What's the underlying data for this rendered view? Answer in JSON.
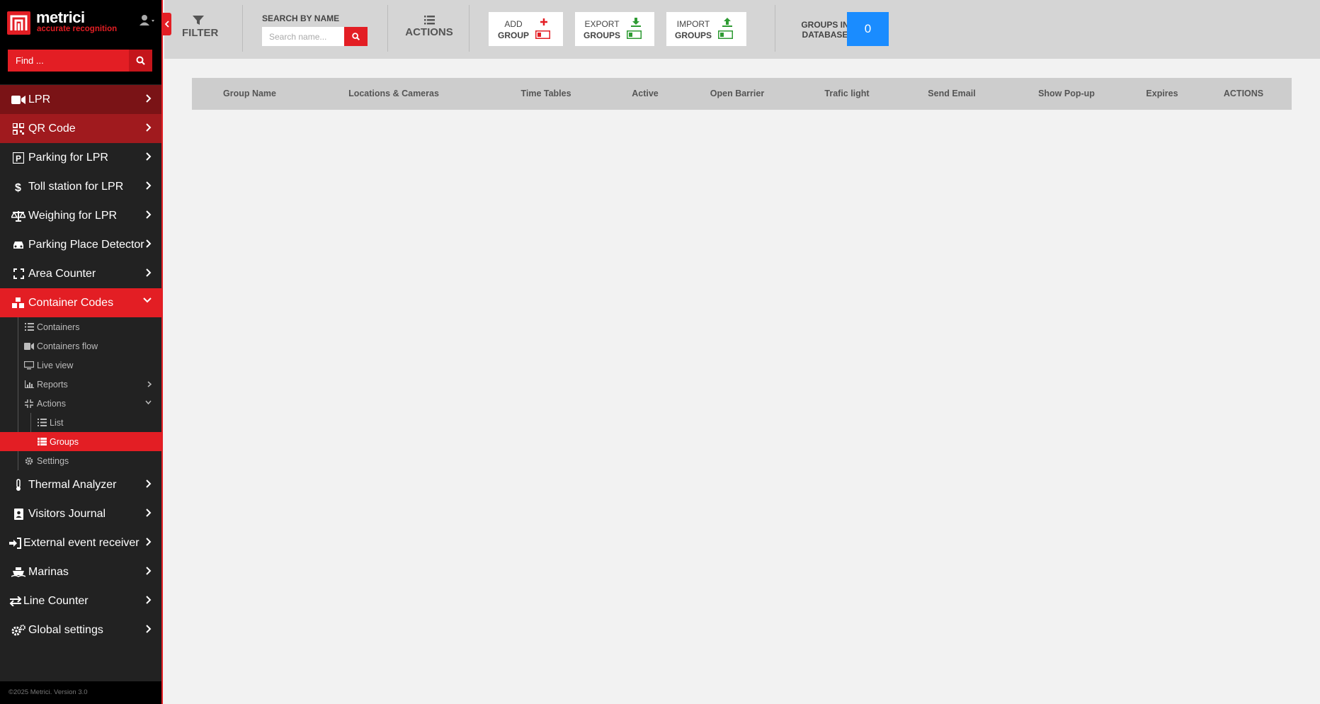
{
  "brand": {
    "name": "metrici",
    "tagline": "accurate recognition",
    "accent": "#e31e24"
  },
  "search_sidebar": {
    "placeholder": "Find ..."
  },
  "nav": [
    {
      "label": "LPR",
      "icon": "video-camera-icon"
    },
    {
      "label": "QR Code",
      "icon": "qr-code-icon"
    },
    {
      "label": "Parking for LPR",
      "icon": "parking-icon"
    },
    {
      "label": "Toll station for LPR",
      "icon": "dollar-icon"
    },
    {
      "label": "Weighing for LPR",
      "icon": "scale-icon"
    },
    {
      "label": "Parking Place Detector",
      "icon": "car-icon"
    },
    {
      "label": "Area Counter",
      "icon": "expand-icon"
    },
    {
      "label": "Container Codes",
      "icon": "cubes-icon"
    }
  ],
  "container_sub": [
    {
      "label": "Containers",
      "icon": "list-icon"
    },
    {
      "label": "Containers flow",
      "icon": "video-icon"
    },
    {
      "label": "Live view",
      "icon": "monitor-icon"
    },
    {
      "label": "Reports",
      "icon": "chart-icon"
    },
    {
      "label": "Actions",
      "icon": "compress-icon"
    }
  ],
  "actions_sub": [
    {
      "label": "List",
      "icon": "list-icon"
    },
    {
      "label": "Groups",
      "icon": "table-icon"
    }
  ],
  "settings_sub": {
    "label": "Settings",
    "icon": "gear-icon"
  },
  "nav_bottom": [
    {
      "label": "Thermal Analyzer",
      "icon": "thermometer-icon"
    },
    {
      "label": "Visitors Journal",
      "icon": "id-badge-icon"
    },
    {
      "label": "External event receiver",
      "icon": "sign-in-icon"
    },
    {
      "label": "Marinas",
      "icon": "ship-icon"
    },
    {
      "label": "Line Counter",
      "icon": "exchange-icon"
    },
    {
      "label": "Global settings",
      "icon": "gears-icon"
    }
  ],
  "footer": "©2025 Metrici. Version 3.0",
  "toolbar": {
    "filter_label": "FILTER",
    "search_label": "SEARCH BY NAME",
    "search_placeholder": "Search name...",
    "actions_label": "ACTIONS",
    "add_line1": "ADD",
    "add_line2": "GROUP",
    "export_line1": "EXPORT",
    "export_line2": "GROUPS",
    "import_line1": "IMPORT",
    "import_line2": "GROUPS",
    "db_line1": "GROUPS IN",
    "db_line2": "DATABASE",
    "db_count": "0"
  },
  "table": {
    "columns": [
      "Group Name",
      "Locations & Cameras",
      "Time Tables",
      "Active",
      "Open Barrier",
      "Trafic light",
      "Send Email",
      "Show Pop-up",
      "Expires",
      "ACTIONS"
    ]
  }
}
